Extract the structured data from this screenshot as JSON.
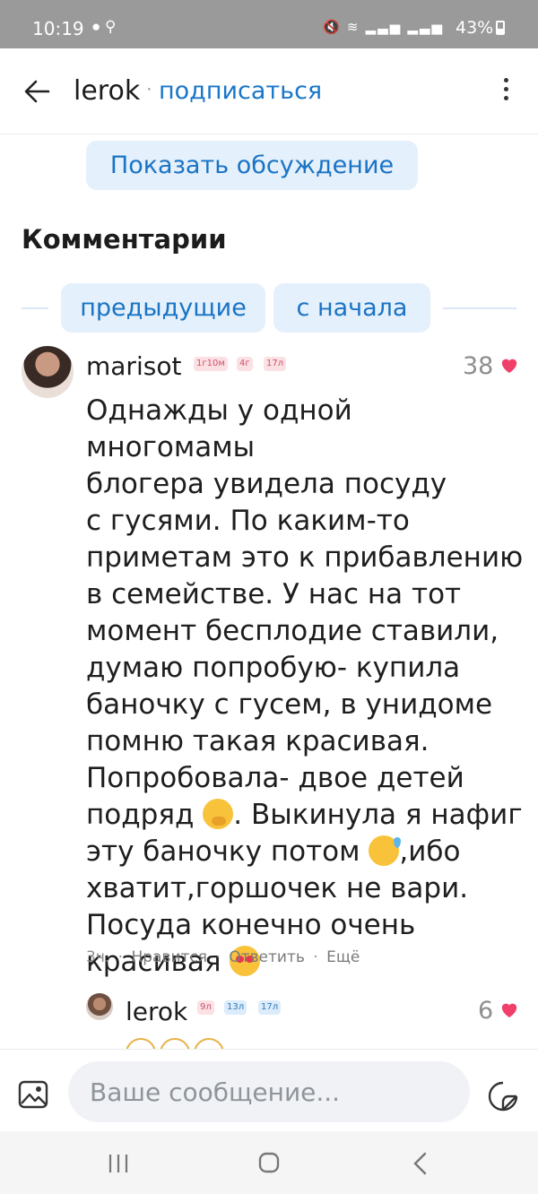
{
  "status_bar": {
    "time": "10:19",
    "battery": "43%",
    "network_1": "Vo) LTE1",
    "network_2": "Vo) LTE2"
  },
  "header": {
    "back_icon": "arrow-left-icon",
    "title": "lerok",
    "separator": "·",
    "subscribe": "подписаться",
    "menu_icon": "more-vertical-icon"
  },
  "show_discussion": "Показать обсуждение",
  "comments_heading": "Комментарии",
  "pager": {
    "previous": "предыдущие",
    "from_start": "с начала"
  },
  "comment": {
    "author": "marisot",
    "badges": [
      "1г10м",
      "4г",
      "17л"
    ],
    "likes": "38",
    "text_lines": [
      "Однажды у одной многомамы",
      "блогера увидела посуду",
      "с гусями. По каким-то",
      "приметам это к прибавлению",
      "в семействе.  У нас на тот",
      "момент бесплодие ставили,",
      "думаю попробую- купила",
      "баночку с гусем, в унидоме",
      "помню такая красивая.",
      "Попробовала- двое детей"
    ],
    "line_11": "подряд",
    "line_11_tail": ". Выкинула я нафиг",
    "line_12": "эту баночку потом",
    "line_12_tail": ",ибо",
    "line_13": "хватит,горшочек не вари.",
    "line_14": "Посуда конечно очень",
    "line_15": "красивая",
    "time": "3ч.",
    "like_action": "Нравится",
    "reply_action": "Ответить",
    "more_action": "Ещё",
    "dot": "·"
  },
  "reply": {
    "author": "lerok",
    "badges": [
      "9л",
      "13л",
      "17л"
    ],
    "likes": "6"
  },
  "composer": {
    "placeholder": "Ваше сообщение...",
    "attach_icon": "image-icon",
    "sticker_icon": "sticker-icon"
  },
  "colors": {
    "accent": "#1976c9",
    "pill_bg": "#e4f0fb",
    "heart": "#f0406a",
    "status_bar": "#9a9a9a"
  }
}
